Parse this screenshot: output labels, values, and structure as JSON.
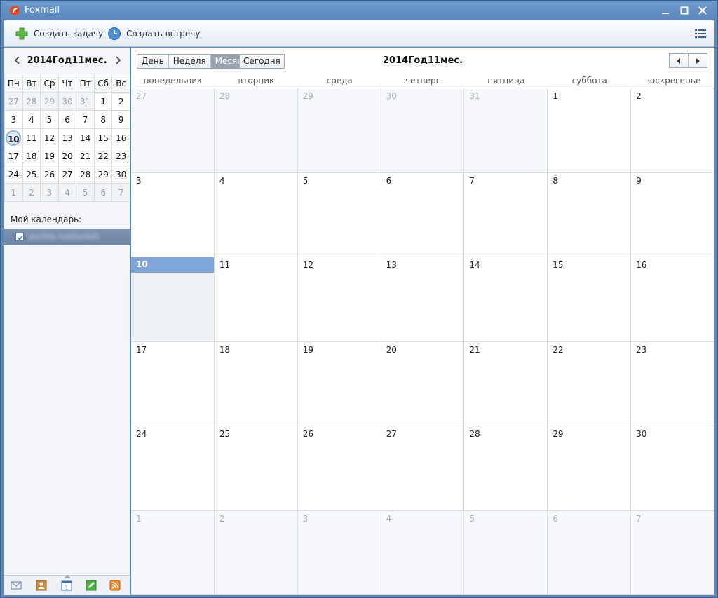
{
  "window": {
    "title": "Foxmail"
  },
  "toolbar": {
    "new_task": "Создать задачу",
    "new_meeting": "Создать встречу"
  },
  "mini_calendar": {
    "title": "2014Год11мес.",
    "weekdays": [
      "Пн",
      "Вт",
      "Ср",
      "Чт",
      "Пт",
      "Сб",
      "Вс"
    ],
    "weeks": [
      [
        {
          "d": "27",
          "o": true
        },
        {
          "d": "28",
          "o": true
        },
        {
          "d": "29",
          "o": true
        },
        {
          "d": "30",
          "o": true
        },
        {
          "d": "31",
          "o": true
        },
        {
          "d": "1"
        },
        {
          "d": "2"
        }
      ],
      [
        {
          "d": "3"
        },
        {
          "d": "4"
        },
        {
          "d": "5"
        },
        {
          "d": "6"
        },
        {
          "d": "7"
        },
        {
          "d": "8"
        },
        {
          "d": "9"
        }
      ],
      [
        {
          "d": "10",
          "t": true
        },
        {
          "d": "11"
        },
        {
          "d": "12"
        },
        {
          "d": "13"
        },
        {
          "d": "14"
        },
        {
          "d": "15"
        },
        {
          "d": "16"
        }
      ],
      [
        {
          "d": "17"
        },
        {
          "d": "18"
        },
        {
          "d": "19"
        },
        {
          "d": "20"
        },
        {
          "d": "21"
        },
        {
          "d": "22"
        },
        {
          "d": "23"
        }
      ],
      [
        {
          "d": "24"
        },
        {
          "d": "25"
        },
        {
          "d": "26"
        },
        {
          "d": "27"
        },
        {
          "d": "28"
        },
        {
          "d": "29"
        },
        {
          "d": "30"
        }
      ],
      [
        {
          "d": "1",
          "o": true
        },
        {
          "d": "2",
          "o": true
        },
        {
          "d": "3",
          "o": true
        },
        {
          "d": "4",
          "o": true
        },
        {
          "d": "5",
          "o": true
        },
        {
          "d": "6",
          "o": true
        },
        {
          "d": "7",
          "o": true
        }
      ]
    ]
  },
  "my_calendars": {
    "label": "Мой календарь:",
    "items": [
      {
        "name": "pochta.ru(blurred)",
        "checked": true
      }
    ]
  },
  "view": {
    "day": "День",
    "week": "Неделя",
    "month": "Месяц",
    "today": "Сегодня",
    "title": "2014Год11мес.",
    "active": "month"
  },
  "month_grid": {
    "weekdays": [
      "понедельник",
      "вторник",
      "среда",
      "четверг",
      "пятница",
      "суббота",
      "воскресенье"
    ],
    "weeks": [
      [
        {
          "d": "27",
          "o": true
        },
        {
          "d": "28",
          "o": true
        },
        {
          "d": "29",
          "o": true
        },
        {
          "d": "30",
          "o": true
        },
        {
          "d": "31",
          "o": true
        },
        {
          "d": "1"
        },
        {
          "d": "2"
        }
      ],
      [
        {
          "d": "3"
        },
        {
          "d": "4"
        },
        {
          "d": "5"
        },
        {
          "d": "6"
        },
        {
          "d": "7"
        },
        {
          "d": "8"
        },
        {
          "d": "9"
        }
      ],
      [
        {
          "d": "10",
          "t": true
        },
        {
          "d": "11"
        },
        {
          "d": "12"
        },
        {
          "d": "13"
        },
        {
          "d": "14"
        },
        {
          "d": "15"
        },
        {
          "d": "16"
        }
      ],
      [
        {
          "d": "17"
        },
        {
          "d": "18"
        },
        {
          "d": "19"
        },
        {
          "d": "20"
        },
        {
          "d": "21"
        },
        {
          "d": "22"
        },
        {
          "d": "23"
        }
      ],
      [
        {
          "d": "24"
        },
        {
          "d": "25"
        },
        {
          "d": "26"
        },
        {
          "d": "27"
        },
        {
          "d": "28"
        },
        {
          "d": "29"
        },
        {
          "d": "30"
        }
      ],
      [
        {
          "d": "1",
          "o": true
        },
        {
          "d": "2",
          "o": true
        },
        {
          "d": "3",
          "o": true
        },
        {
          "d": "4",
          "o": true
        },
        {
          "d": "5",
          "o": true
        },
        {
          "d": "6",
          "o": true
        },
        {
          "d": "7",
          "o": true
        }
      ]
    ]
  },
  "bottom_nav": [
    "mail-icon",
    "contacts-icon",
    "calendar-icon",
    "notes-icon",
    "rss-icon"
  ],
  "colors": {
    "accent": "#7fa5d6",
    "titlebar": "#5d87b8",
    "selected_calendar": "#7390b2"
  }
}
